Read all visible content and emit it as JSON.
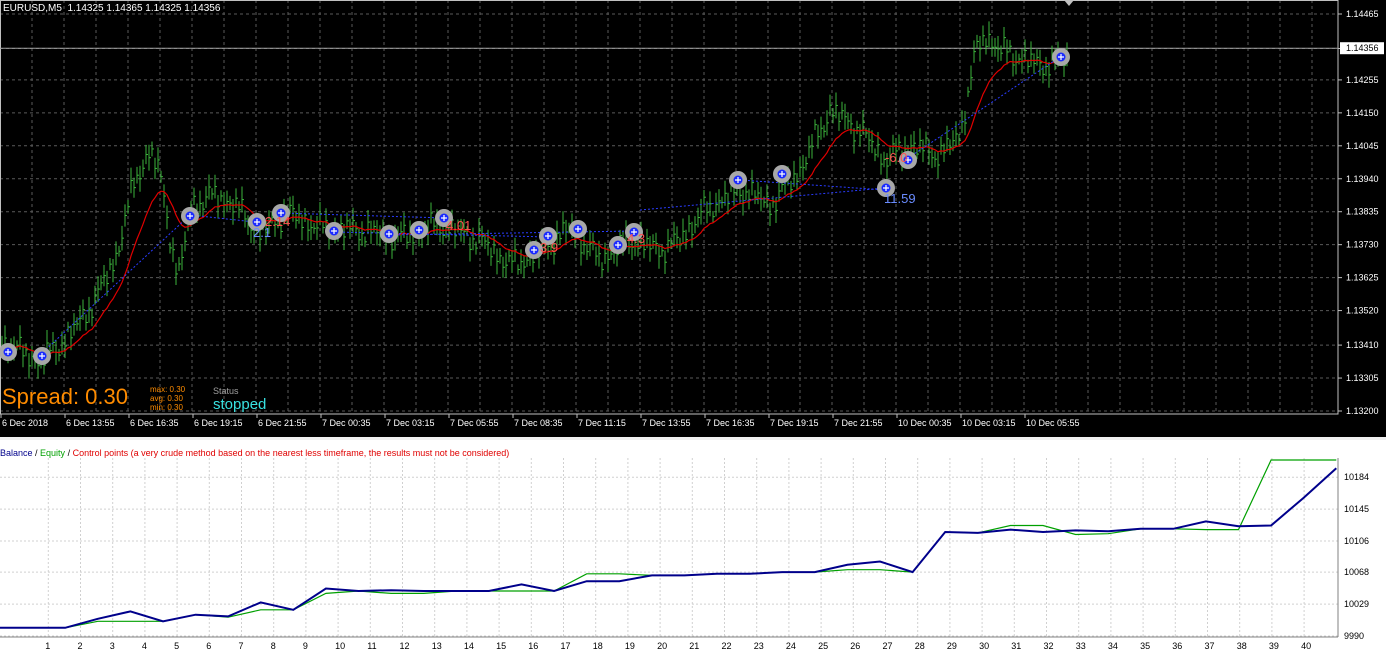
{
  "chart": {
    "symbol_info": "EURUSD,M5  1.14325 1.14365 1.14325 1.14356",
    "current_price": "1.14356",
    "price_ticks": [
      "1.14465",
      "1.14355",
      "1.14255",
      "1.14150",
      "1.14045",
      "1.13940",
      "1.13835",
      "1.13730",
      "1.13625",
      "1.13520",
      "1.13410",
      "1.13305",
      "1.13200"
    ],
    "time_labels": [
      "6 Dec 2018",
      "6 Dec 13:55",
      "6 Dec 16:35",
      "6 Dec 19:15",
      "6 Dec 21:55",
      "7 Dec 00:35",
      "7 Dec 03:15",
      "7 Dec 05:55",
      "7 Dec 08:35",
      "7 Dec 11:15",
      "7 Dec 13:55",
      "7 Dec 16:35",
      "7 Dec 19:15",
      "7 Dec 21:55",
      "10 Dec 00:35",
      "10 Dec 03:15",
      "10 Dec 05:55"
    ],
    "spread_text": "Spread: 0.30",
    "spread_stats": {
      "max": "max: 0.30",
      "avg": "avg: 0.30",
      "min": "min: 0.30"
    },
    "status_label": "Status",
    "status_value": "stopped",
    "trade_labels": [
      {
        "text": "2.14",
        "color": "#ff5050"
      },
      {
        "text": "2.1",
        "color": "#6a8cff"
      },
      {
        "text": "4.01",
        "color": "#ff5050"
      },
      {
        "text": "3.9",
        "color": "#ff5050"
      },
      {
        "text": "4.3",
        "color": "#ff5050"
      },
      {
        "text": "-6.0",
        "color": "#ff5050"
      },
      {
        "text": "11.59",
        "color": "#6a8cff"
      }
    ],
    "colors": {
      "bars": "#3cb33c",
      "ma": "#e00000",
      "grid": "#5a5a5a",
      "trade_line": "#2a3cff"
    }
  },
  "tester": {
    "legend": {
      "balance": "Balance",
      "sep1": " / ",
      "equity": "Equity",
      "sep2": " / ",
      "control": "Control points (a very crude method based on the nearest less timeframe, the results must not be considered)"
    },
    "y_ticks": [
      "10184",
      "10145",
      "10106",
      "10068",
      "10029",
      "9990"
    ],
    "x_ticks": [
      "1",
      "2",
      "3",
      "4",
      "5",
      "6",
      "7",
      "8",
      "9",
      "10",
      "11",
      "12",
      "13",
      "14",
      "15",
      "16",
      "17",
      "18",
      "19",
      "20",
      "21",
      "22",
      "23",
      "24",
      "25",
      "26",
      "27",
      "28",
      "29",
      "30",
      "31",
      "32",
      "33",
      "34",
      "35",
      "36",
      "37",
      "38",
      "39",
      "40"
    ],
    "balance": [
      10000,
      10000,
      10000,
      10011,
      10020,
      10008,
      10016,
      10014,
      10031,
      10022,
      10048,
      10045,
      10046,
      10045,
      10045,
      10045,
      10053,
      10045,
      10057,
      10057,
      10064,
      10064,
      10066,
      10066,
      10068,
      10068,
      10077,
      10081,
      10068,
      10117,
      10116,
      10120,
      10117,
      10119,
      10118,
      10121,
      10121,
      10130,
      10124,
      10125,
      10159,
      10195
    ],
    "equity": [
      10000,
      10000,
      10000,
      10008,
      10008,
      10008,
      10016,
      10013,
      10022,
      10022,
      10042,
      10045,
      10042,
      10042,
      10045,
      10045,
      10045,
      10045,
      10066,
      10066,
      10064,
      10064,
      10066,
      10066,
      10068,
      10068,
      10071,
      10071,
      10068,
      10117,
      10116,
      10125,
      10125,
      10114,
      10115,
      10121,
      10121,
      10120,
      10120,
      10205,
      10205,
      10205
    ],
    "colors": {
      "balance": "#00008b",
      "equity": "#00a000",
      "control": "#e00000"
    }
  }
}
